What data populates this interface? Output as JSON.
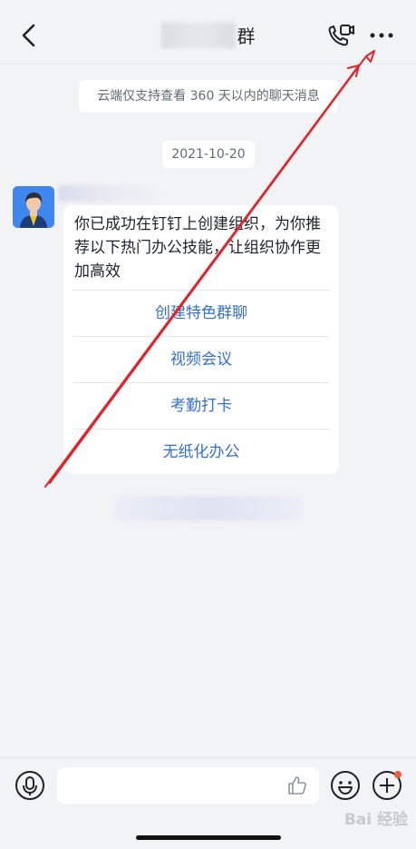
{
  "header": {
    "title_suffix": "群",
    "back_icon": "chevron-left-icon",
    "video_icon": "video-call-icon",
    "more_icon": "more-icon"
  },
  "chat": {
    "system_notice": "云端仅支持查看 360 天以内的聊天消息",
    "date": "2021-10-20",
    "card": {
      "text": "你已成功在钉钉上创建组织，为你推荐以下热门办公技能，让组织协作更加高效",
      "actions": [
        "创建特色群聊",
        "视频会议",
        "考勤打卡",
        "无纸化办公"
      ]
    }
  },
  "input_bar": {
    "mic_icon": "microphone-icon",
    "like_icon": "thumbs-up-icon",
    "emoji_icon": "emoji-icon",
    "plus_icon": "plus-icon"
  },
  "watermark": "Bai 经验",
  "colors": {
    "background": "#f2f3f5",
    "link_blue": "#3370cc",
    "annotation_red": "#e0242b",
    "notification_dot": "#f05d3b"
  }
}
